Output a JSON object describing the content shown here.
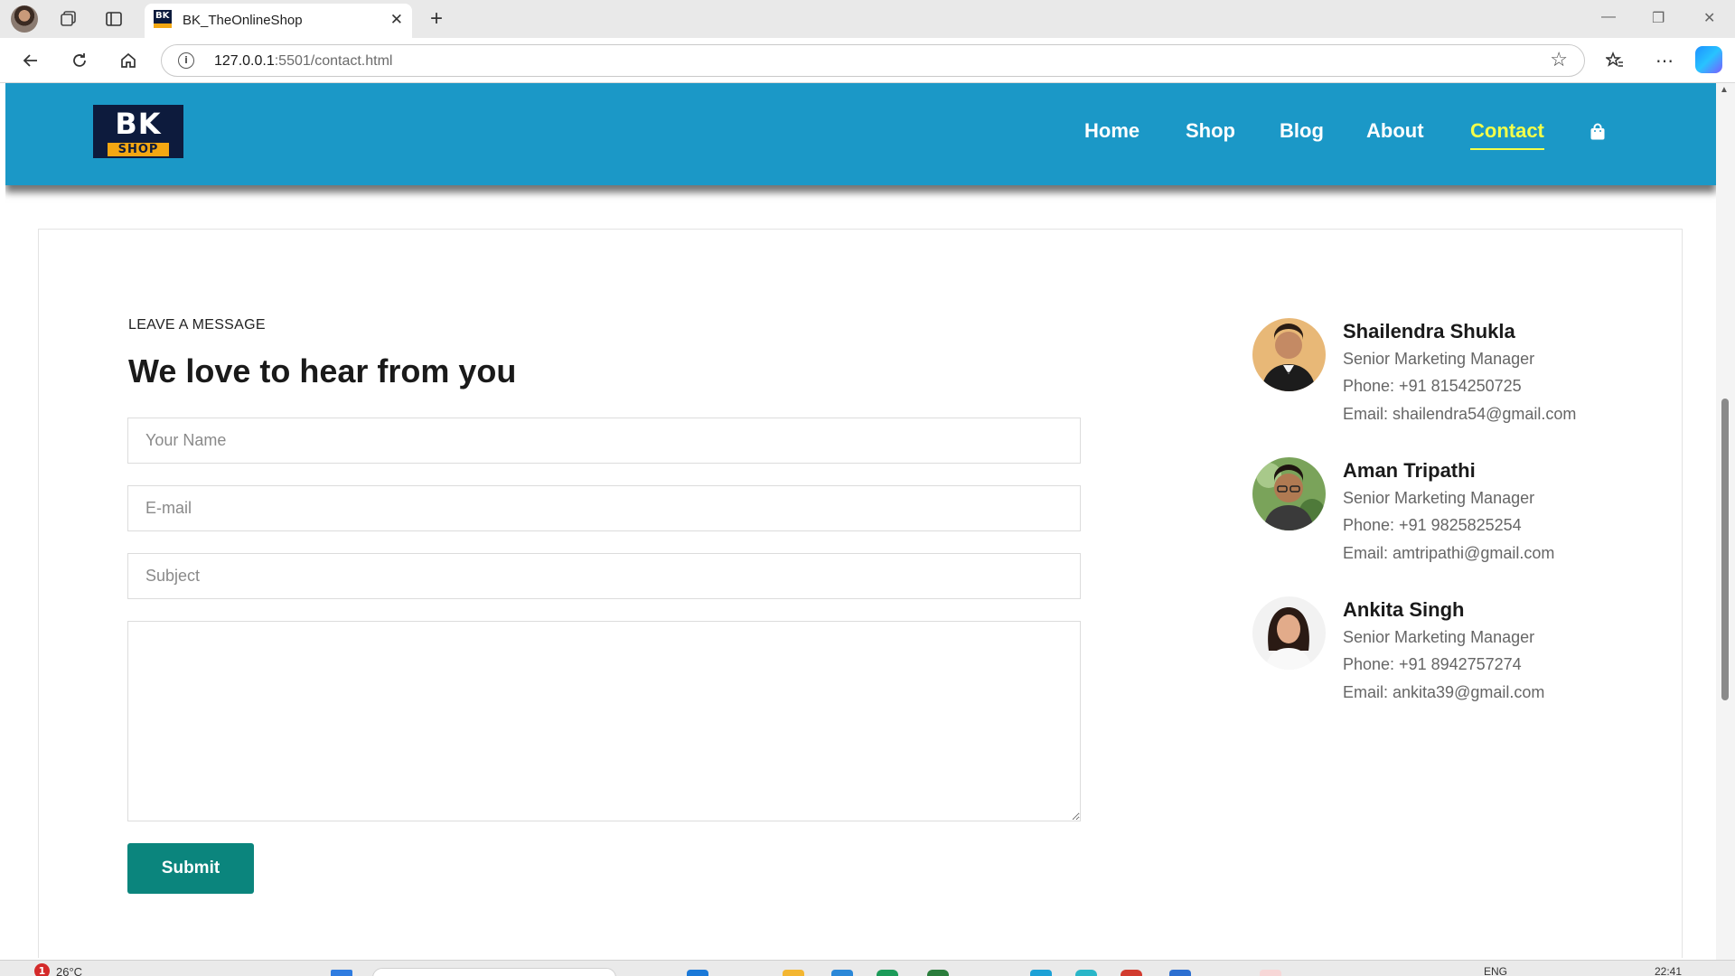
{
  "browser": {
    "tab_title": "BK_TheOnlineShop",
    "url_host": "127.0.0.1",
    "url_rest": ":5501/contact.html"
  },
  "site": {
    "logo_top": "BK",
    "logo_bottom": "SHOP",
    "nav": [
      "Home",
      "Shop",
      "Blog",
      "About",
      "Contact"
    ],
    "active_nav": "Contact",
    "brand_color": "#1b98c7",
    "accent_color": "#f3ff4a"
  },
  "contact_form": {
    "eyebrow": "LEAVE A MESSAGE",
    "headline": "We love to hear from you",
    "name_placeholder": "Your Name",
    "email_placeholder": "E-mail",
    "subject_placeholder": "Subject",
    "message_placeholder": "",
    "submit_label": "Submit",
    "submit_color": "#0b857d"
  },
  "team": [
    {
      "name": "Shailendra Shukla",
      "role": "Senior Marketing Manager",
      "phone": "Phone: +91 8154250725",
      "email": "Email: shailendra54@gmail.com"
    },
    {
      "name": "Aman Tripathi",
      "role": "Senior Marketing Manager",
      "phone": "Phone: +91 9825825254",
      "email": "Email: amtripathi@gmail.com"
    },
    {
      "name": "Ankita Singh",
      "role": "Senior Marketing Manager",
      "phone": "Phone: +91 8942757274",
      "email": "Email: ankita39@gmail.com"
    }
  ],
  "taskbar": {
    "notification_count": "1",
    "temperature": "26°C",
    "language": "ENG",
    "time": "22:41"
  }
}
